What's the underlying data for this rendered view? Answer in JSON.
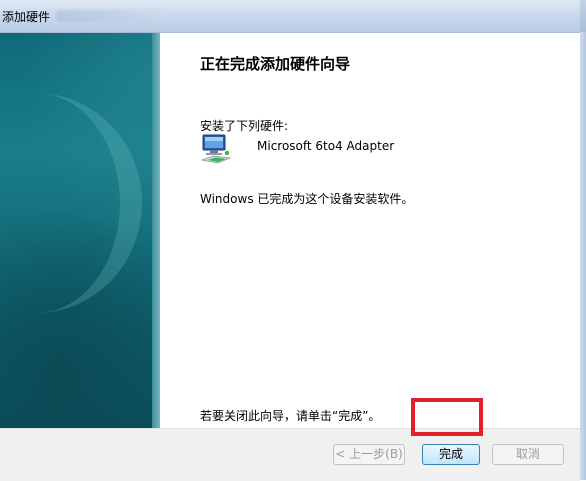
{
  "window": {
    "title": "添加硬件"
  },
  "wizard": {
    "heading": "正在完成添加硬件向导",
    "installed_label": "安装了下列硬件:",
    "device": {
      "name": "Microsoft 6to4 Adapter",
      "icon": "network-adapter-icon"
    },
    "status_text": "Windows 已完成为这个设备安装软件。",
    "finish_hint": "若要关闭此向导，请单击“完成”。"
  },
  "buttons": {
    "back": "< 上一步(B)",
    "finish": "完成",
    "cancel": "取消"
  },
  "colors": {
    "highlight": "#e0202a",
    "sidebar": "#0f6a78"
  }
}
